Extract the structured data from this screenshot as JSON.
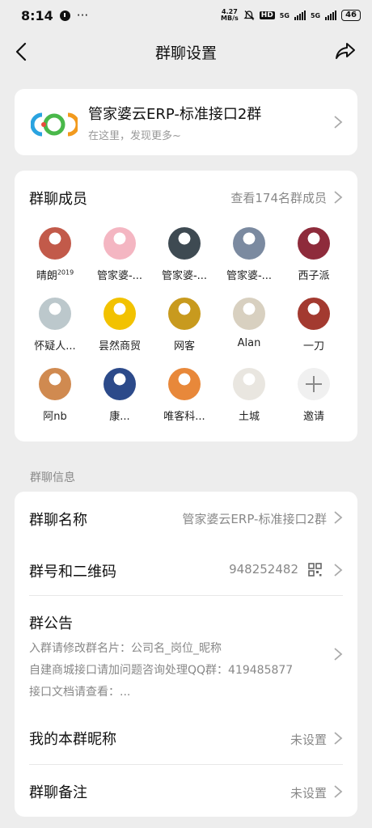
{
  "status_bar": {
    "time": "8:14",
    "more": "···",
    "net_speed_value": "4.27",
    "net_speed_unit": "MB/s",
    "hd": "HD",
    "net1": "5G",
    "net2": "5G",
    "battery": "46"
  },
  "nav": {
    "title": "群聊设置"
  },
  "group": {
    "name": "管家婆云ERP-标准接口2群",
    "subtitle": "在这里，发现更多~"
  },
  "members": {
    "title": "群聊成员",
    "view_all": "查看174名群成员",
    "list": [
      {
        "name": "晴朗",
        "sup": "2019",
        "color": "#c25a4a",
        "icon": "anime-girl-avatar"
      },
      {
        "name": "管家婆-...",
        "color": "#f4b6c2",
        "icon": "pink-cat-avatar"
      },
      {
        "name": "管家婆-...",
        "color": "#3e4a52",
        "icon": "soldier-avatar"
      },
      {
        "name": "管家婆-...",
        "color": "#7b8aa0",
        "icon": "person-photo-avatar"
      },
      {
        "name": "西子派",
        "color": "#8e2b3b",
        "icon": "red-abstract-avatar"
      },
      {
        "name": "怀疑人...",
        "color": "#bcc8cc",
        "icon": "cartoon-man-avatar"
      },
      {
        "name": "昙然商贸",
        "color": "#f2c200",
        "icon": "yellow-pixel-avatar"
      },
      {
        "name": "网客",
        "color": "#c89a1e",
        "icon": "gold-bars-avatar"
      },
      {
        "name": "Alan",
        "color": "#d8d0c0",
        "icon": "sketch-man-avatar"
      },
      {
        "name": "一刀",
        "color": "#a33a30",
        "icon": "person-red-avatar"
      },
      {
        "name": "阿nb",
        "color": "#d08a50",
        "icon": "sunset-avatar"
      },
      {
        "name": "康...",
        "color": "#2c4a8a",
        "icon": "vw-logo-avatar"
      },
      {
        "name": "唯客科...",
        "color": "#e8883a",
        "icon": "fox-avatar"
      },
      {
        "name": "土城",
        "color": "#e9e6e0",
        "icon": "top-hat-avatar"
      }
    ],
    "invite_label": "邀请"
  },
  "section_info_label": "群聊信息",
  "info": {
    "group_name_label": "群聊名称",
    "group_name_value": "管家婆云ERP-标准接口2群",
    "group_number_label": "群号和二维码",
    "group_number_value": "948252482",
    "notice_label": "群公告",
    "notice_lines": [
      "入群请修改群名片：公司名_岗位_昵称",
      "自建商城接口请加问题咨询处理QQ群：419485877",
      "接口文档请查看：..."
    ],
    "my_nick_label": "我的本群昵称",
    "my_nick_value": "未设置",
    "remark_label": "群聊备注",
    "remark_value": "未设置"
  }
}
